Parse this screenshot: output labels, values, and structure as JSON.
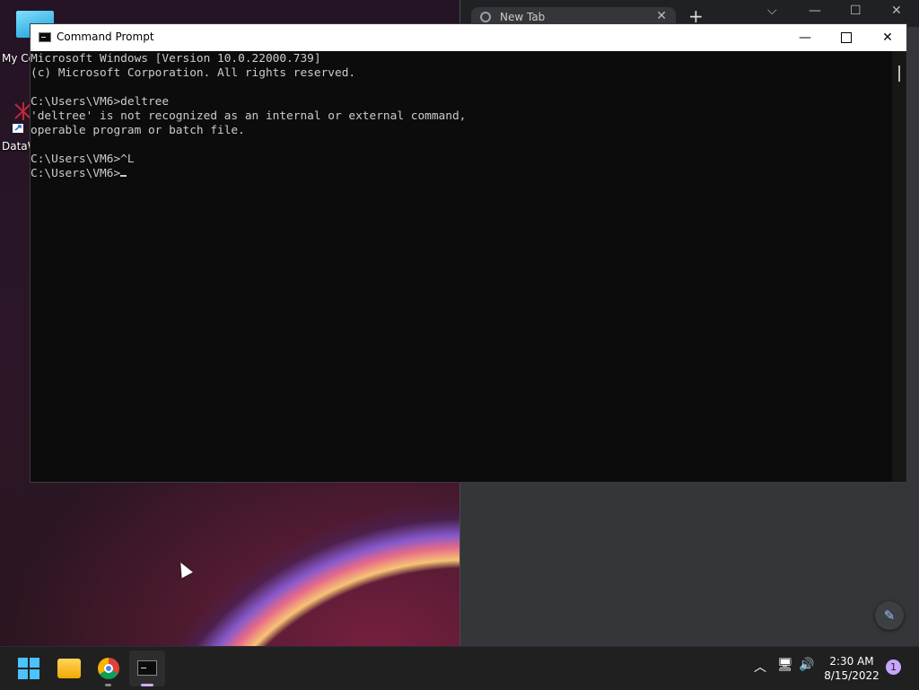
{
  "desktop": {
    "icons": [
      {
        "label": "My Co",
        "icon": "computer-icon"
      },
      {
        "label": "DataW",
        "icon": "app-shortcut-icon"
      }
    ]
  },
  "browser": {
    "tab_title": "New Tab",
    "tab_close": "✕",
    "new_tab": "+",
    "controls": {
      "dropdown": "⌵",
      "minimize": "—",
      "maximize": "☐",
      "close": "✕"
    },
    "edit_button": "✎"
  },
  "cmd_window": {
    "title": "Command Prompt",
    "controls": {
      "minimize": "—",
      "close": "✕"
    },
    "lines": [
      "Microsoft Windows [Version 10.0.22000.739]",
      "(c) Microsoft Corporation. All rights reserved.",
      "",
      "C:\\Users\\VM6>deltree",
      "'deltree' is not recognized as an internal or external command,",
      "operable program or batch file.",
      "",
      "C:\\Users\\VM6>^L",
      "C:\\Users\\VM6>"
    ]
  },
  "taskbar": {
    "apps": [
      "start-icon",
      "file-explorer-icon",
      "chrome-icon",
      "command-prompt-icon"
    ],
    "tray": {
      "chevron": "︿",
      "network": "🖥",
      "volume": "🔊"
    },
    "clock": {
      "time": "2:30 AM",
      "date": "8/15/2022"
    },
    "notification_count": "1",
    "colors": {
      "accent": "#4cc2ff",
      "active_underline": "#d6a8ff"
    }
  }
}
